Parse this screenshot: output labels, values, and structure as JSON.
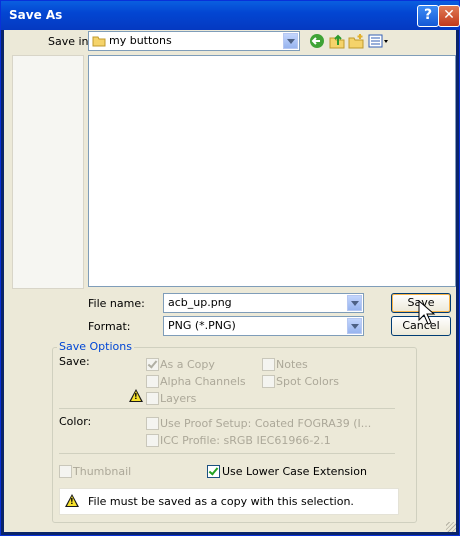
{
  "window": {
    "title": "Save As"
  },
  "save_in": {
    "label": "Save in:",
    "value": "my buttons"
  },
  "file_name": {
    "label": "File name:",
    "value": "acb_up.png"
  },
  "format": {
    "label": "Format:",
    "value": "PNG (*.PNG)"
  },
  "buttons": {
    "save": "Save",
    "cancel": "Cancel"
  },
  "save_options": {
    "title": "Save Options",
    "save_label": "Save:",
    "as_a_copy": "As a Copy",
    "notes": "Notes",
    "alpha_channels": "Alpha Channels",
    "spot_colors": "Spot Colors",
    "layers": "Layers",
    "color_label": "Color:",
    "use_proof_setup": "Use Proof Setup:  Coated FOGRA39 (I...",
    "icc_profile": "ICC Profile:  sRGB IEC61966-2.1",
    "thumbnail": "Thumbnail",
    "use_lower_case_extension": "Use Lower Case Extension",
    "warning": "File must be saved as a copy with this selection."
  },
  "icons": [
    "back-arrow-icon",
    "up-folder-icon",
    "new-folder-icon",
    "view-menu-icon",
    "warning-icon",
    "help-icon",
    "close-icon"
  ]
}
